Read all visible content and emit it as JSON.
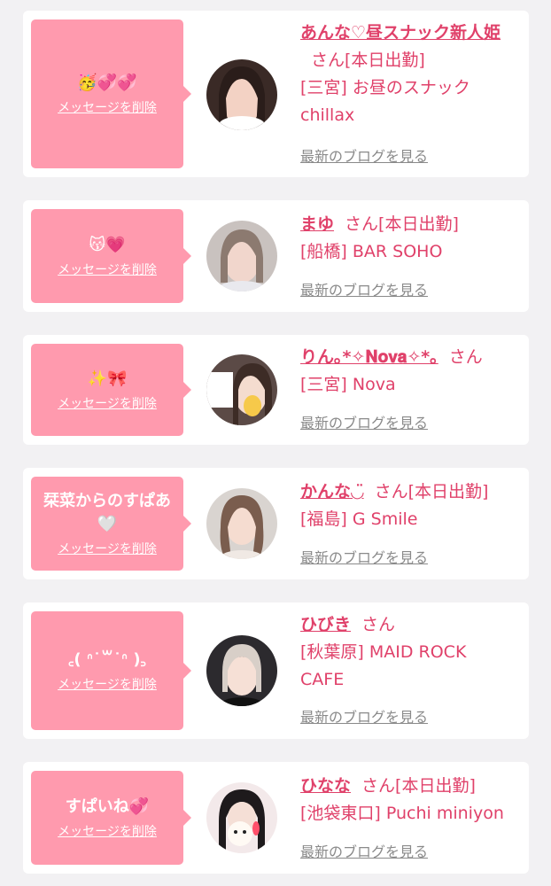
{
  "delete_label": "メッセージを削除",
  "blog_label": "最新のブログを見る",
  "honorific": "さん",
  "cards": [
    {
      "message": "🥳💞💞",
      "name": "あんな♡昼スナック新人姫",
      "status": "[本日出勤]",
      "shop": "[三宮] お昼のスナックchillax",
      "avatar_icon": "girl-portrait-icon"
    },
    {
      "message": "😽💗",
      "name": "まゆ",
      "status": "[本日出勤]",
      "shop": "[船橋] BAR SOHO",
      "avatar_icon": "girl-portrait-icon"
    },
    {
      "message": "✨🎀",
      "name": "りん｡*✧𝐍𝐨𝐯𝐚✧*｡",
      "status": "",
      "shop": "[三宮] Nova",
      "avatar_icon": "girl-portrait-icon"
    },
    {
      "message": "栞菜からのすぱあ\n🤍",
      "name": "かんな◡̈",
      "status": "[本日出勤]",
      "shop": "[福島] G Smile",
      "avatar_icon": "girl-portrait-icon"
    },
    {
      "message": "꜀( ᐢ˙꒳˙ᐢ )꜆",
      "name": "ひびき",
      "status": "",
      "shop": "[秋葉原] MAID ROCK CAFE",
      "avatar_icon": "girl-portrait-icon"
    },
    {
      "message": "すぱいね💞",
      "name": "ひなな",
      "status": "[本日出勤]",
      "shop": "[池袋東口] Puchi miniyon",
      "avatar_icon": "girl-portrait-icon"
    }
  ],
  "colors": {
    "accent": "#e0416a",
    "bubble": "#ff9aae",
    "background": "#f2f1f3",
    "muted": "#8a8a8a"
  }
}
